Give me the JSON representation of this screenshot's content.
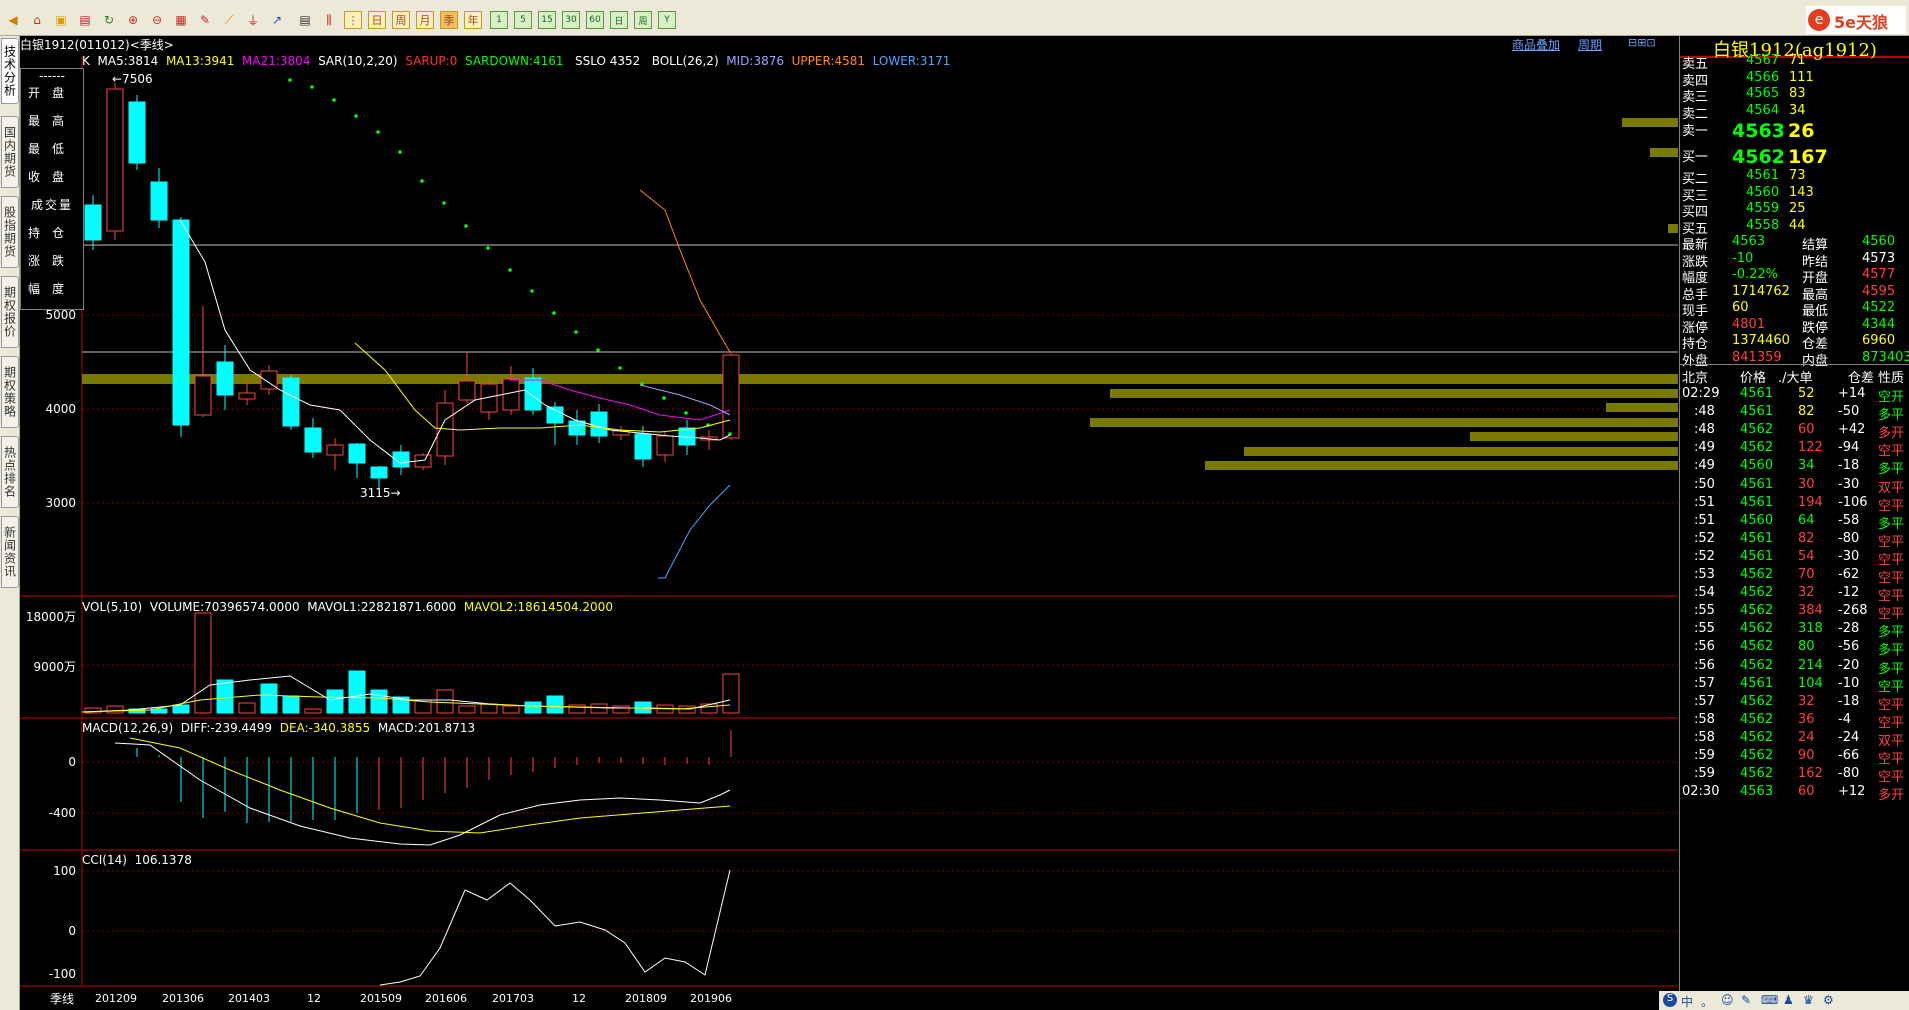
{
  "toolbar": {
    "ticks_labels": [
      "1",
      "5",
      "15",
      "30",
      "60",
      "日",
      "周"
    ],
    "period_buttons": [
      "日",
      "周",
      "月",
      "季",
      "年"
    ]
  },
  "sidebar": {
    "tabs": [
      "技术分析",
      "国内期货",
      "股指期货",
      "期权报价",
      "期权策略",
      "热点排名",
      "新闻资讯"
    ]
  },
  "chart": {
    "title": "白银1912(011012)<季线>",
    "links": [
      "商品叠加",
      "周期"
    ],
    "legend": {
      "dash": "------",
      "items": [
        "开盘",
        "最高",
        "最低",
        "收盘",
        "成交量",
        "持仓",
        "涨跌",
        "幅度"
      ]
    },
    "main_indicators": [
      {
        "text": "K",
        "color": "#ffffff"
      },
      {
        "text": "MA5:3814",
        "color": "#ffffff"
      },
      {
        "text": "MA13:3941",
        "color": "#ffff00"
      },
      {
        "text": "MA21:3804",
        "color": "#ff00ff"
      },
      {
        "text": "SAR(10,2,20)",
        "color": "#ffffff"
      },
      {
        "text": "SARUP:0",
        "color": "#ff3030"
      },
      {
        "text": "SARDOWN:4161",
        "color": "#00ff00"
      },
      {
        "text": "SSLO 4352",
        "color": "#ffffff"
      },
      {
        "text": "BOLL(26,2)",
        "color": "#ffffff"
      },
      {
        "text": "MID:3876",
        "color": "#a0a0ff"
      },
      {
        "text": "UPPER:4581",
        "color": "#ff8c00"
      },
      {
        "text": "LOWER:3171",
        "color": "#4aa8ff"
      }
    ],
    "high_marker": "←7506",
    "low_marker": "3115→",
    "main_yaxis": [
      "5000",
      "4000",
      "3000"
    ],
    "vol_indicators": [
      {
        "text": "VOL(5,10)",
        "color": "#ffffff"
      },
      {
        "text": "VOLUME:70396574.0000",
        "color": "#ffffff"
      },
      {
        "text": "MAVOL1:22821871.6000",
        "color": "#ffffff"
      },
      {
        "text": "MAVOL2:18614504.2000",
        "color": "#ffff00"
      }
    ],
    "vol_yaxis": [
      "18000万",
      "9000万"
    ],
    "macd_indicators": [
      {
        "text": "MACD(12,26,9)",
        "color": "#ffffff"
      },
      {
        "text": "DIFF:-239.4499",
        "color": "#ffffff"
      },
      {
        "text": "DEA:-340.3855",
        "color": "#ffff00"
      },
      {
        "text": "MACD:201.8713",
        "color": "#ffffff"
      }
    ],
    "macd_yaxis": [
      "0",
      "-400"
    ],
    "cci_indicators": [
      {
        "text": "CCI(14)",
        "color": "#ffffff"
      },
      {
        "text": "106.1378",
        "color": "#ffffff"
      }
    ],
    "cci_yaxis": [
      "100",
      "0",
      "-100"
    ],
    "period_label": "季线",
    "xaxis": [
      "201209",
      "201306",
      "201403",
      "12",
      "201509",
      "201606",
      "201703",
      "12",
      "201809",
      "201906"
    ]
  },
  "quote": {
    "title": "白银1912(ag1912)",
    "asks": [
      {
        "label": "卖五",
        "price": "4567",
        "vol": "71"
      },
      {
        "label": "卖四",
        "price": "4566",
        "vol": "111"
      },
      {
        "label": "卖三",
        "price": "4565",
        "vol": "83"
      },
      {
        "label": "卖二",
        "price": "4564",
        "vol": "34"
      }
    ],
    "ask1": {
      "label": "卖一",
      "price": "4563",
      "vol": "26"
    },
    "bid1": {
      "label": "买一",
      "price": "4562",
      "vol": "167"
    },
    "bids": [
      {
        "label": "买二",
        "price": "4561",
        "vol": "73"
      },
      {
        "label": "买三",
        "price": "4560",
        "vol": "143"
      },
      {
        "label": "买四",
        "price": "4559",
        "vol": "25"
      },
      {
        "label": "买五",
        "price": "4558",
        "vol": "44"
      }
    ],
    "stats": [
      {
        "l1": "最新",
        "v1": "4563",
        "c1": "grn",
        "l2": "结算",
        "v2": "4560",
        "c2": "grn"
      },
      {
        "l1": "涨跌",
        "v1": "-10",
        "c1": "grn",
        "l2": "昨结",
        "v2": "4573",
        "c2": "wht"
      },
      {
        "l1": "幅度",
        "v1": "-0.22%",
        "c1": "grn",
        "l2": "开盘",
        "v2": "4577",
        "c2": "red"
      },
      {
        "l1": "总手",
        "v1": "1714762",
        "c1": "yel",
        "l2": "最高",
        "v2": "4595",
        "c2": "red"
      },
      {
        "l1": "现手",
        "v1": "60",
        "c1": "yel",
        "l2": "最低",
        "v2": "4522",
        "c2": "grn"
      },
      {
        "l1": "涨停",
        "v1": "4801",
        "c1": "red",
        "l2": "跌停",
        "v2": "4344",
        "c2": "grn"
      },
      {
        "l1": "持仓",
        "v1": "1374460",
        "c1": "yel",
        "l2": "仓差",
        "v2": "6960",
        "c2": "yel"
      },
      {
        "l1": "外盘",
        "v1": "841359",
        "c1": "red",
        "l2": "内盘",
        "v2": "873403",
        "c2": "grn"
      }
    ],
    "ticks_header": [
      "北京",
      "价格",
      "./大单",
      "仓差",
      "性质"
    ],
    "ticks": [
      {
        "t": "02:29",
        "p": "4561",
        "pc": "grn",
        "v": "52",
        "vc": "yel",
        "d": "+14",
        "dc": "wht",
        "n": "空开",
        "nc": "grn"
      },
      {
        "t": ":48",
        "p": "4561",
        "pc": "grn",
        "v": "82",
        "vc": "yel",
        "d": "-50",
        "dc": "wht",
        "n": "多平",
        "nc": "grn"
      },
      {
        "t": ":48",
        "p": "4562",
        "pc": "grn",
        "v": "60",
        "vc": "red",
        "d": "+42",
        "dc": "wht",
        "n": "多开",
        "nc": "red"
      },
      {
        "t": ":49",
        "p": "4562",
        "pc": "grn",
        "v": "122",
        "vc": "red",
        "d": "-94",
        "dc": "wht",
        "n": "空平",
        "nc": "red"
      },
      {
        "t": ":49",
        "p": "4560",
        "pc": "grn",
        "v": "34",
        "vc": "grn",
        "d": "-18",
        "dc": "wht",
        "n": "多平",
        "nc": "grn"
      },
      {
        "t": ":50",
        "p": "4561",
        "pc": "grn",
        "v": "30",
        "vc": "red",
        "d": "-30",
        "dc": "wht",
        "n": "双平",
        "nc": "red"
      },
      {
        "t": ":51",
        "p": "4561",
        "pc": "grn",
        "v": "194",
        "vc": "red",
        "d": "-106",
        "dc": "wht",
        "n": "空平",
        "nc": "red"
      },
      {
        "t": ":51",
        "p": "4560",
        "pc": "grn",
        "v": "64",
        "vc": "grn",
        "d": "-58",
        "dc": "wht",
        "n": "多平",
        "nc": "grn"
      },
      {
        "t": ":52",
        "p": "4561",
        "pc": "grn",
        "v": "82",
        "vc": "red",
        "d": "-80",
        "dc": "wht",
        "n": "空平",
        "nc": "red"
      },
      {
        "t": ":52",
        "p": "4561",
        "pc": "grn",
        "v": "54",
        "vc": "red",
        "d": "-30",
        "dc": "wht",
        "n": "空平",
        "nc": "red"
      },
      {
        "t": ":53",
        "p": "4562",
        "pc": "grn",
        "v": "70",
        "vc": "red",
        "d": "-62",
        "dc": "wht",
        "n": "空平",
        "nc": "red"
      },
      {
        "t": ":54",
        "p": "4562",
        "pc": "grn",
        "v": "32",
        "vc": "red",
        "d": "-12",
        "dc": "wht",
        "n": "空平",
        "nc": "red"
      },
      {
        "t": ":55",
        "p": "4562",
        "pc": "grn",
        "v": "384",
        "vc": "red",
        "d": "-268",
        "dc": "wht",
        "n": "空平",
        "nc": "red"
      },
      {
        "t": ":55",
        "p": "4562",
        "pc": "grn",
        "v": "318",
        "vc": "grn",
        "d": "-28",
        "dc": "wht",
        "n": "多平",
        "nc": "grn"
      },
      {
        "t": ":56",
        "p": "4562",
        "pc": "grn",
        "v": "80",
        "vc": "grn",
        "d": "-56",
        "dc": "wht",
        "n": "多平",
        "nc": "grn"
      },
      {
        "t": ":56",
        "p": "4562",
        "pc": "grn",
        "v": "214",
        "vc": "grn",
        "d": "-20",
        "dc": "wht",
        "n": "多平",
        "nc": "grn"
      },
      {
        "t": ":57",
        "p": "4561",
        "pc": "grn",
        "v": "104",
        "vc": "grn",
        "d": "-10",
        "dc": "wht",
        "n": "空平",
        "nc": "grn"
      },
      {
        "t": ":57",
        "p": "4562",
        "pc": "grn",
        "v": "32",
        "vc": "red",
        "d": "-18",
        "dc": "wht",
        "n": "空平",
        "nc": "red"
      },
      {
        "t": ":58",
        "p": "4562",
        "pc": "grn",
        "v": "36",
        "vc": "red",
        "d": "-4",
        "dc": "wht",
        "n": "空平",
        "nc": "red"
      },
      {
        "t": ":58",
        "p": "4562",
        "pc": "grn",
        "v": "24",
        "vc": "red",
        "d": "-24",
        "dc": "wht",
        "n": "双平",
        "nc": "red"
      },
      {
        "t": ":59",
        "p": "4562",
        "pc": "grn",
        "v": "90",
        "vc": "red",
        "d": "-66",
        "dc": "wht",
        "n": "空平",
        "nc": "red"
      },
      {
        "t": ":59",
        "p": "4562",
        "pc": "grn",
        "v": "162",
        "vc": "red",
        "d": "-80",
        "dc": "wht",
        "n": "空平",
        "nc": "red"
      },
      {
        "t": "02:30",
        "p": "4563",
        "pc": "grn",
        "v": "60",
        "vc": "red",
        "d": "+12",
        "dc": "wht",
        "n": "多开",
        "nc": "red"
      }
    ]
  },
  "brand": "5e天狼",
  "statusbar": [
    "中",
    "。",
    "☺"
  ]
}
